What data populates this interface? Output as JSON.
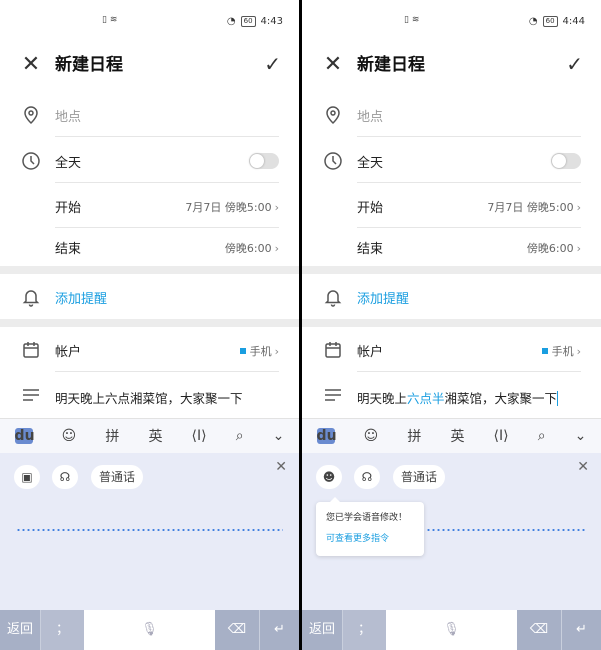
{
  "screens": [
    {
      "status": {
        "time": "4:43",
        "battery": "60"
      },
      "title": "新建日程",
      "location_placeholder": "地点",
      "allday_label": "全天",
      "start_label": "开始",
      "start_value": "7月7日 傍晚5:00",
      "end_label": "结束",
      "end_value": "傍晚6:00",
      "reminder_label": "添加提醒",
      "account_label": "帐户",
      "account_value": "手机",
      "note": {
        "pre": "明天晚上六点湘菜馆，大家聚一下",
        "hl": "",
        "post": ""
      },
      "ime": {
        "pinyin": "拼",
        "english": "英"
      },
      "voice": {
        "mandarin": "普通话"
      },
      "bottom": {
        "back": "返回",
        "semicolon": "；"
      }
    },
    {
      "status": {
        "time": "4:44",
        "battery": "60"
      },
      "title": "新建日程",
      "location_placeholder": "地点",
      "allday_label": "全天",
      "start_label": "开始",
      "start_value": "7月7日 傍晚5:00",
      "end_label": "结束",
      "end_value": "傍晚6:00",
      "reminder_label": "添加提醒",
      "account_label": "帐户",
      "account_value": "手机",
      "note": {
        "pre": "明天晚上",
        "hl": "六点半",
        "post": "湘菜馆，大家聚一下"
      },
      "ime": {
        "pinyin": "拼",
        "english": "英"
      },
      "voice": {
        "mandarin": "普通话"
      },
      "tooltip": {
        "line1": "您已学会语音修改！",
        "line2": "可查看更多指令"
      },
      "bottom": {
        "back": "返回",
        "semicolon": "；"
      }
    }
  ]
}
